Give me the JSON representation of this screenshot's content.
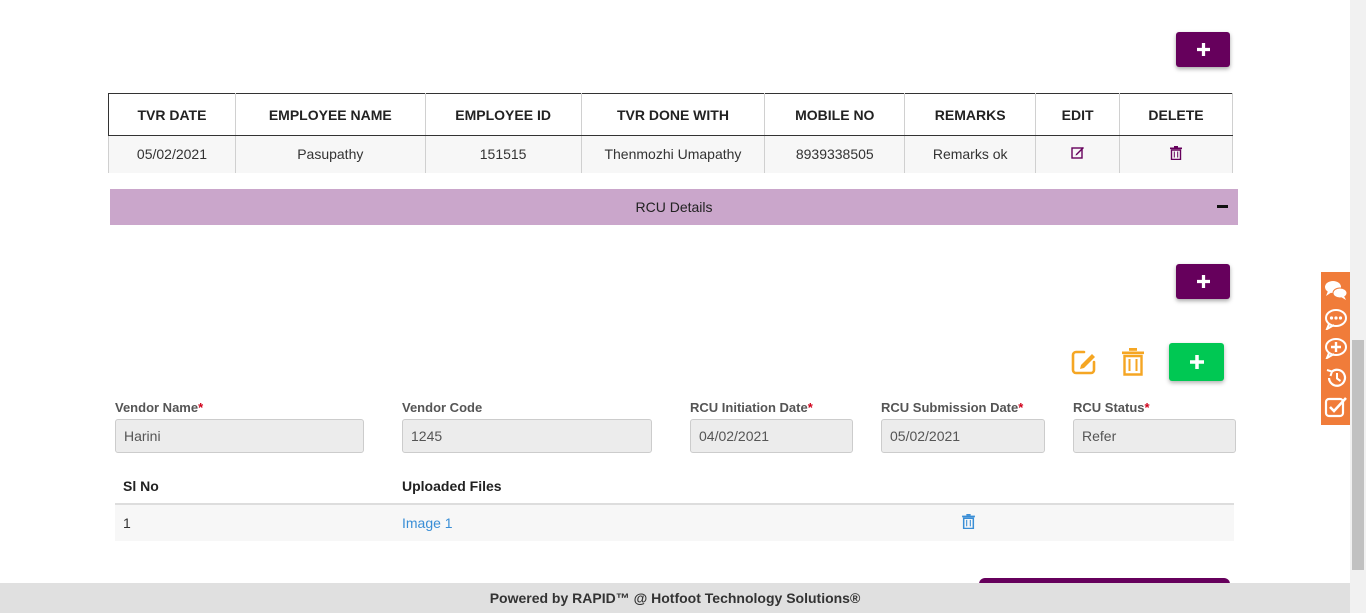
{
  "tvr": {
    "columns": [
      "TVR DATE",
      "EMPLOYEE NAME",
      "EMPLOYEE ID",
      "TVR DONE WITH",
      "MOBILE NO",
      "REMARKS",
      "EDIT",
      "DELETE"
    ],
    "rows": [
      [
        "05/02/2021",
        "Pasupathy",
        "151515",
        "Thenmozhi Umapathy",
        "8939338505",
        "Remarks ok"
      ]
    ]
  },
  "rcu": {
    "title": "RCU Details",
    "fields": {
      "vendor_name": {
        "label": "Vendor Name",
        "required": "*",
        "value": "Harini"
      },
      "vendor_code": {
        "label": "Vendor Code",
        "value": "1245"
      },
      "initiation_date": {
        "label": "RCU Initiation Date",
        "required": "*",
        "value": "04/02/2021"
      },
      "submission_date": {
        "label": "RCU Submission Date",
        "required": "*",
        "value": "05/02/2021"
      },
      "status": {
        "label": "RCU Status",
        "required": "*",
        "value": "Refer"
      }
    },
    "files": {
      "headers": {
        "sl_no": "Sl No",
        "uploaded": "Uploaded Files"
      },
      "rows": [
        {
          "sl_no": "1",
          "file": "Image 1"
        }
      ]
    }
  },
  "footer": {
    "text": "Powered by RAPID™ @ Hotfoot Technology Solutions®"
  },
  "colors": {
    "primary": "#66005c",
    "section_bar": "#caa6cb",
    "green": "#00c853",
    "orange": "#f5a623",
    "toolbar": "#f07c3a",
    "link": "#3a8ed6"
  },
  "icons": [
    "plus-icon",
    "minus-icon",
    "edit-icon",
    "trash-icon",
    "chat-icon",
    "comment-icon",
    "add-comment-icon",
    "history-icon",
    "checklist-icon"
  ]
}
